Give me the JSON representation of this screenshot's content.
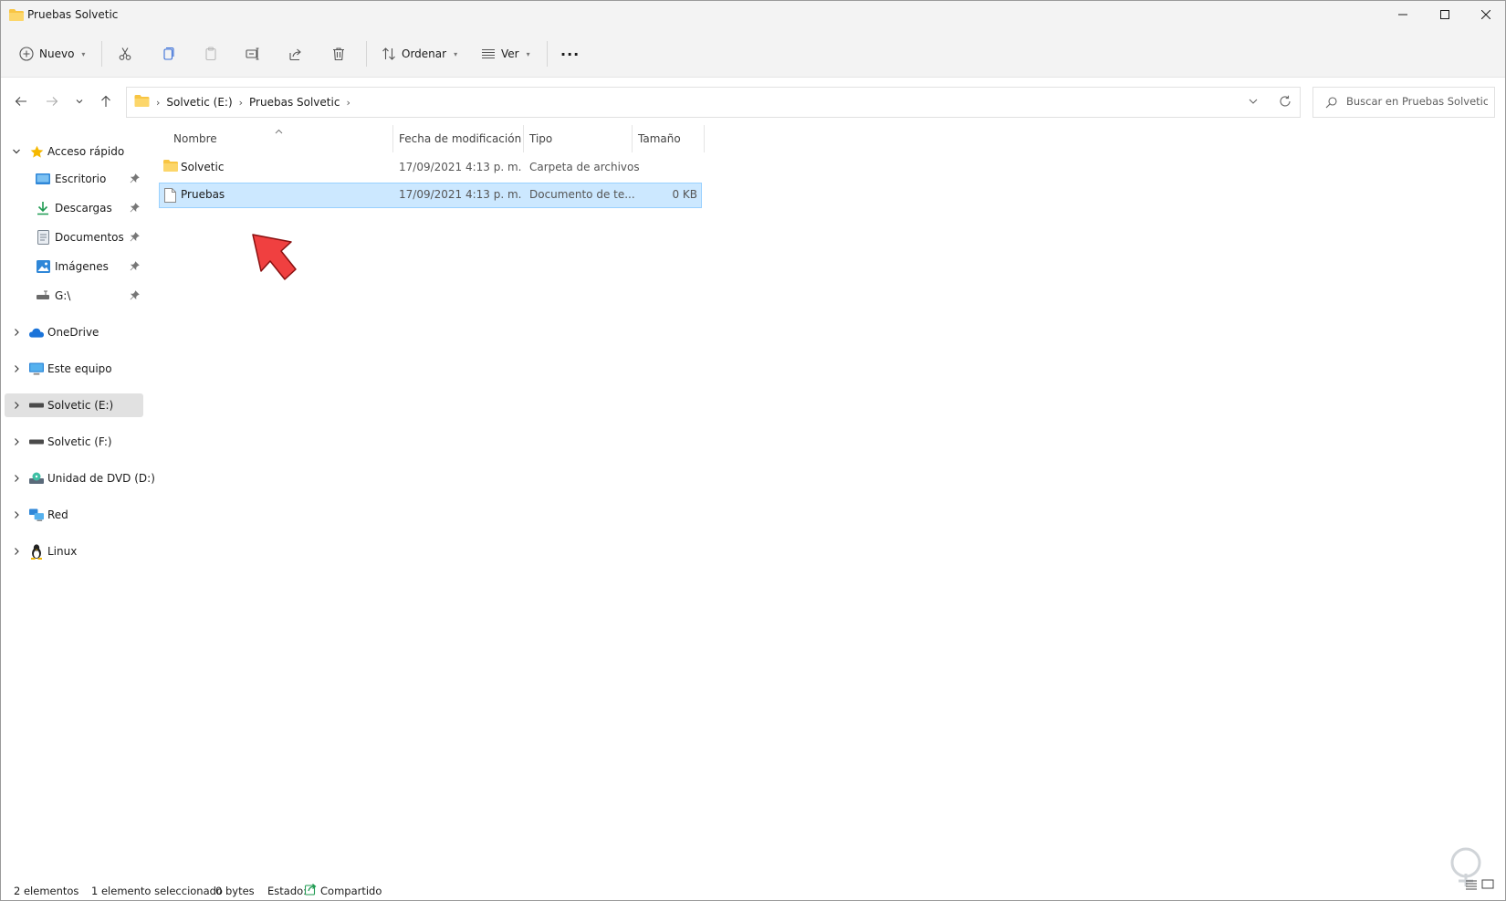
{
  "window": {
    "title": "Pruebas Solvetic"
  },
  "commandbar": {
    "new_label": "Nuevo",
    "sort_label": "Ordenar",
    "view_label": "Ver",
    "more_label": "···"
  },
  "address": {
    "crumbs": [
      "Solvetic (E:)",
      "Pruebas Solvetic"
    ],
    "search_placeholder": "Buscar en Pruebas Solvetic"
  },
  "sidebar": {
    "quick_access": "Acceso rápido",
    "quick_items": [
      {
        "label": "Escritorio",
        "icon": "desktop-icon"
      },
      {
        "label": "Descargas",
        "icon": "download-icon"
      },
      {
        "label": "Documentos",
        "icon": "documents-icon"
      },
      {
        "label": "Imágenes",
        "icon": "pictures-icon"
      },
      {
        "label": "G:\\",
        "icon": "network-drive-icon"
      }
    ],
    "items": [
      {
        "label": "OneDrive",
        "icon": "cloud-icon"
      },
      {
        "label": "Este equipo",
        "icon": "computer-icon"
      },
      {
        "label": "Solvetic (E:)",
        "icon": "drive-icon",
        "selected": true
      },
      {
        "label": "Solvetic (F:)",
        "icon": "drive-icon"
      },
      {
        "label": "Unidad de DVD (D:)",
        "icon": "dvd-icon"
      },
      {
        "label": "Red",
        "icon": "network-icon"
      },
      {
        "label": "Linux",
        "icon": "linux-icon"
      }
    ]
  },
  "filelist": {
    "columns": [
      "Nombre",
      "Fecha de modificación",
      "Tipo",
      "Tamaño"
    ],
    "rows": [
      {
        "name": "Solvetic",
        "date": "17/09/2021 4:13 p. m.",
        "type": "Carpeta de archivos",
        "size": "",
        "icon": "folder-icon"
      },
      {
        "name": "Pruebas",
        "date": "17/09/2021 4:13 p. m.",
        "type": "Documento de te...",
        "size": "0 KB",
        "icon": "text-file-icon",
        "selected": true
      }
    ]
  },
  "statusbar": {
    "count": "2 elementos",
    "selection": "1 elemento seleccionado",
    "size": "0 bytes",
    "state_label": "Estado:",
    "state_value": "Compartido"
  },
  "colors": {
    "selection_bg": "#cce8ff",
    "selection_border": "#99d1ff",
    "folder": "#f8c543",
    "arrow": "#f04040"
  }
}
